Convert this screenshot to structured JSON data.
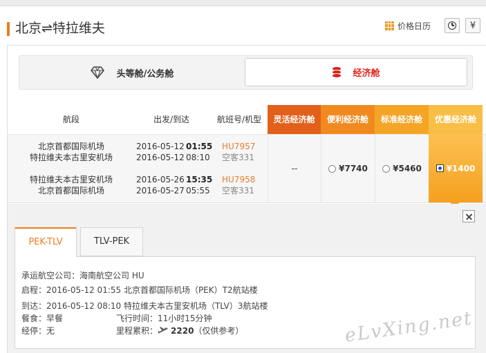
{
  "header": {
    "route_title": "北京⇌特拉维夫",
    "calendar_label": "价格日历",
    "filter_symbol": "¥"
  },
  "cabins": {
    "business_label": "头等舱/公务舱",
    "economy_label": "经济舱"
  },
  "table": {
    "col_segment": "航段",
    "col_time": "出发/到达",
    "col_flight": "航班号/机型",
    "fares": [
      {
        "label": "灵活经济舱",
        "color": "#e2601a"
      },
      {
        "label": "便利经济舱",
        "color": "#f08a1f"
      },
      {
        "label": "标准经济舱",
        "color": "#f4a526"
      },
      {
        "label": "优惠经济舱",
        "color": "#f8be45"
      }
    ]
  },
  "row": {
    "legs": [
      {
        "from": "北京首都国际机场",
        "to": "特拉维夫本古里安机场",
        "dep_date": "2016-05-12",
        "dep_time": "01:55",
        "arr_date": "2016-05-12",
        "arr_time": "08:10",
        "flight": "HU7957",
        "aircraft": "空客331"
      },
      {
        "from": "特拉维夫本古里安机场",
        "to": "北京首都国际机场",
        "dep_date": "2016-05-26",
        "dep_time": "15:35",
        "arr_date": "2016-05-27",
        "arr_time": "05:55",
        "flight": "HU7958",
        "aircraft": "空客331"
      }
    ],
    "prices": {
      "flexible": "--",
      "convenient": "¥7740",
      "standard": "¥5460",
      "discount": "¥1400"
    }
  },
  "detail": {
    "tabs": [
      "PEK-TLV",
      "TLV-PEK"
    ],
    "carrier": "承运航空公司：海南航空公司 HU",
    "departure": "启程：2016-05-12 01:55 北京首都国际机场（PEK）T2航站楼",
    "arrival": "到达：2016-05-12 08:10 特拉维夫本古里安机场（TLV）3航站楼",
    "meal": "餐食：早餐",
    "duration": "飞行时间：11小时15分钟",
    "stop": "经停：无",
    "miles_label": "里程累积：",
    "miles_value": "2220",
    "miles_note": "（仅供参考）"
  },
  "watermark": "eLvXing.net",
  "icons": {
    "calendar": "calendar-grid-icon",
    "clock": "clock-icon",
    "filter": "yen-icon",
    "business": "diamond-icon",
    "economy": "coin-stack-icon",
    "close": "close-icon",
    "miles": "plane-icon"
  }
}
